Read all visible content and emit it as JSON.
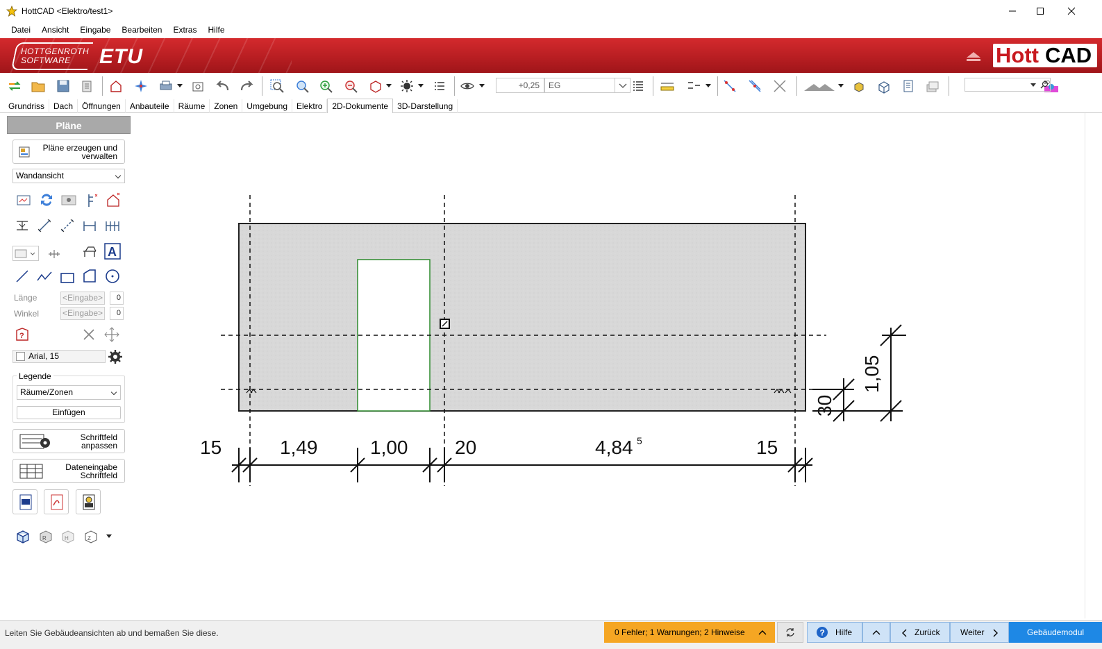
{
  "window": {
    "title": "HottCAD <Elektro/test1>"
  },
  "menu": [
    "Datei",
    "Ansicht",
    "Eingabe",
    "Bearbeiten",
    "Extras",
    "Hilfe"
  ],
  "banner": {
    "company_line1": "Hottgenroth",
    "company_line2": "Software",
    "etu": "ETU",
    "brand_hott": "Hott",
    "brand_cad": "CAD"
  },
  "toolbar": {
    "height_value": "+0,25",
    "floor_value": "EG",
    "search_value": ""
  },
  "tabs": [
    {
      "label": "Grundriss",
      "active": false
    },
    {
      "label": "Dach",
      "active": false
    },
    {
      "label": "Öffnungen",
      "active": false
    },
    {
      "label": "Anbauteile",
      "active": false
    },
    {
      "label": "Räume",
      "active": false
    },
    {
      "label": "Zonen",
      "active": false
    },
    {
      "label": "Umgebung",
      "active": false
    },
    {
      "label": "Elektro",
      "active": false
    },
    {
      "label": "2D-Dokumente",
      "active": true
    },
    {
      "label": "3D-Darstellung",
      "active": false
    }
  ],
  "panel": {
    "header": "Pläne",
    "create_plans_line1": "Pläne erzeugen und",
    "create_plans_line2": "verwalten",
    "view_select": "Wandansicht",
    "length_label": "Länge",
    "angle_label": "Winkel",
    "input_placeholder": "<Eingabe>",
    "mini_value": "0",
    "font_value": "Arial, 15",
    "legend_title": "Legende",
    "legend_select": "Räume/Zonen",
    "legend_insert": "Einfügen",
    "titleblock_adjust_line1": "Schriftfeld",
    "titleblock_adjust_line2": "anpassen",
    "titleblock_data_line1": "Dateneingabe",
    "titleblock_data_line2": "Schriftfeld"
  },
  "drawing": {
    "dimensions_horizontal": [
      "15",
      "1,49",
      "1,00",
      "20",
      "4,84",
      "15"
    ],
    "dimension_superscript": "5",
    "dimensions_vertical": [
      "30",
      "1,05"
    ]
  },
  "status": {
    "message": "Leiten Sie Gebäudeansichten ab und bemaßen Sie diese.",
    "warnings": "0 Fehler; 1 Warnungen; 2 Hinweise",
    "help": "Hilfe",
    "back": "Zurück",
    "next": "Weiter",
    "module": "Gebäudemodul"
  },
  "colors": {
    "banner_red": "#c8191f",
    "warning_orange": "#f5a623",
    "module_blue": "#1e88e5",
    "opening_green": "#2e8b2e"
  }
}
